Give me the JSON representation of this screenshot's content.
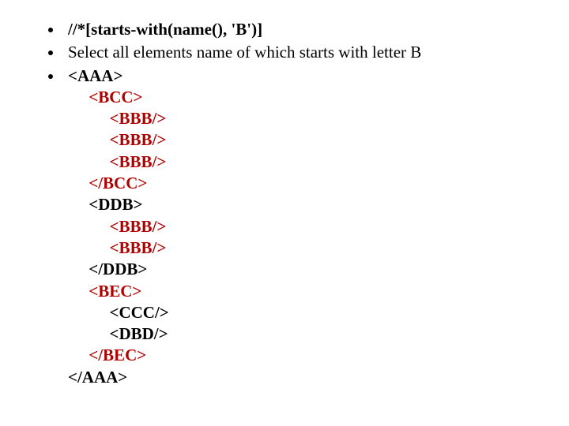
{
  "bullets": {
    "b1": "//*[starts-with(name(), 'B')]",
    "b2": "Select all elements name of which starts with letter B"
  },
  "xml": {
    "l1": "<AAA>",
    "l2": "     <BCC>",
    "l3": "          <BBB/>",
    "l4": "          <BBB/>",
    "l5": "          <BBB/>",
    "l6": "     </BCC>",
    "l7": "     <DDB>",
    "l8": "          <BBB/>",
    "l9": "          <BBB/>",
    "l10": "     </DDB>",
    "l11": "     <BEC>",
    "l12": "          <CCC/>",
    "l13": "          <DBD/>",
    "l14": "     </BEC>",
    "l15": "</AAA>"
  }
}
